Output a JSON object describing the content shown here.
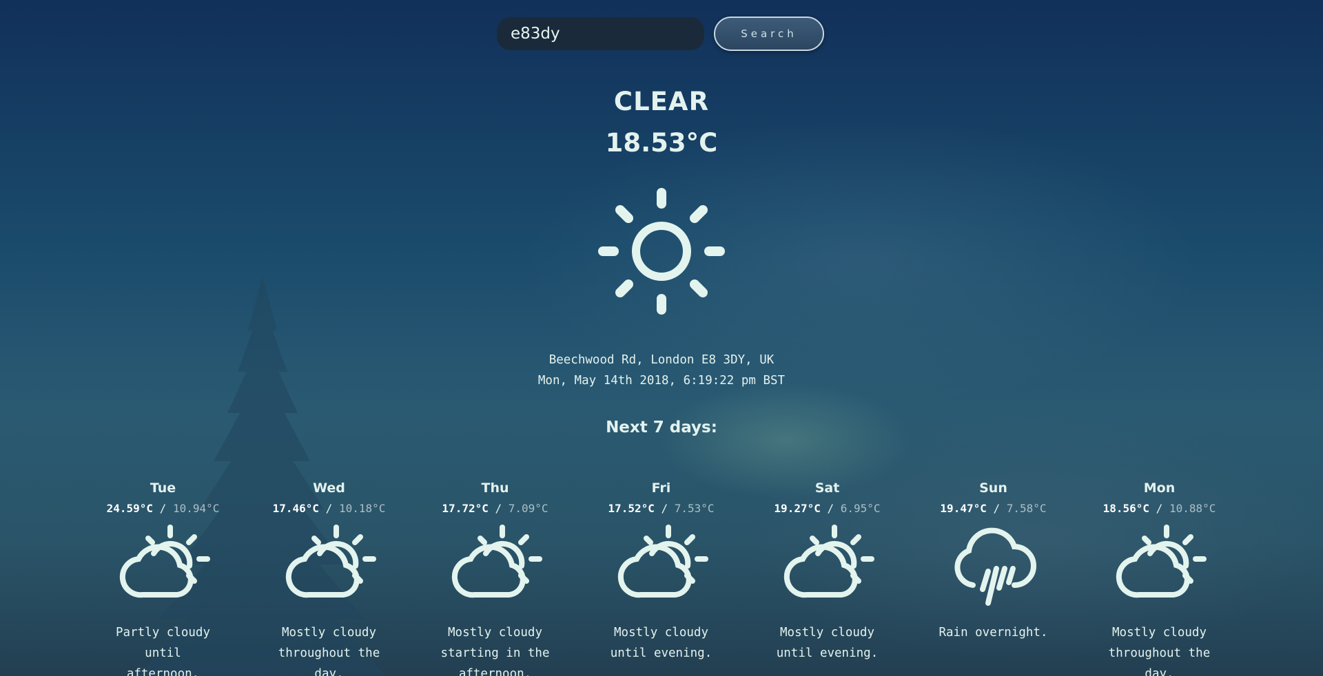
{
  "search": {
    "value": "e83dy",
    "button_label": "Search"
  },
  "current": {
    "condition": "CLEAR",
    "temperature": "18.53°C",
    "icon": "sun-icon",
    "location": "Beechwood Rd, London E8 3DY, UK",
    "datetime": "Mon, May 14th 2018, 6:19:22 pm BST"
  },
  "forecast": {
    "title": "Next 7 days:",
    "days": [
      {
        "name": "Tue",
        "high": "24.59°C",
        "low": "10.94°C",
        "icon": "partly-cloudy-icon",
        "summary": "Partly cloudy until afternoon."
      },
      {
        "name": "Wed",
        "high": "17.46°C",
        "low": "10.18°C",
        "icon": "partly-cloudy-icon",
        "summary": "Mostly cloudy throughout the day."
      },
      {
        "name": "Thu",
        "high": "17.72°C",
        "low": "7.09°C",
        "icon": "partly-cloudy-icon",
        "summary": "Mostly cloudy starting in the afternoon."
      },
      {
        "name": "Fri",
        "high": "17.52°C",
        "low": "7.53°C",
        "icon": "partly-cloudy-icon",
        "summary": "Mostly cloudy until evening."
      },
      {
        "name": "Sat",
        "high": "19.27°C",
        "low": "6.95°C",
        "icon": "partly-cloudy-icon",
        "summary": "Mostly cloudy until evening."
      },
      {
        "name": "Sun",
        "high": "19.47°C",
        "low": "7.58°C",
        "icon": "rain-icon",
        "summary": "Rain overnight."
      },
      {
        "name": "Mon",
        "high": "18.56°C",
        "low": "10.88°C",
        "icon": "partly-cloudy-icon",
        "summary": "Mostly cloudy throughout the day."
      }
    ]
  },
  "colors": {
    "icon": "#e3f4ee",
    "input_bg": "#1b2a3a"
  }
}
